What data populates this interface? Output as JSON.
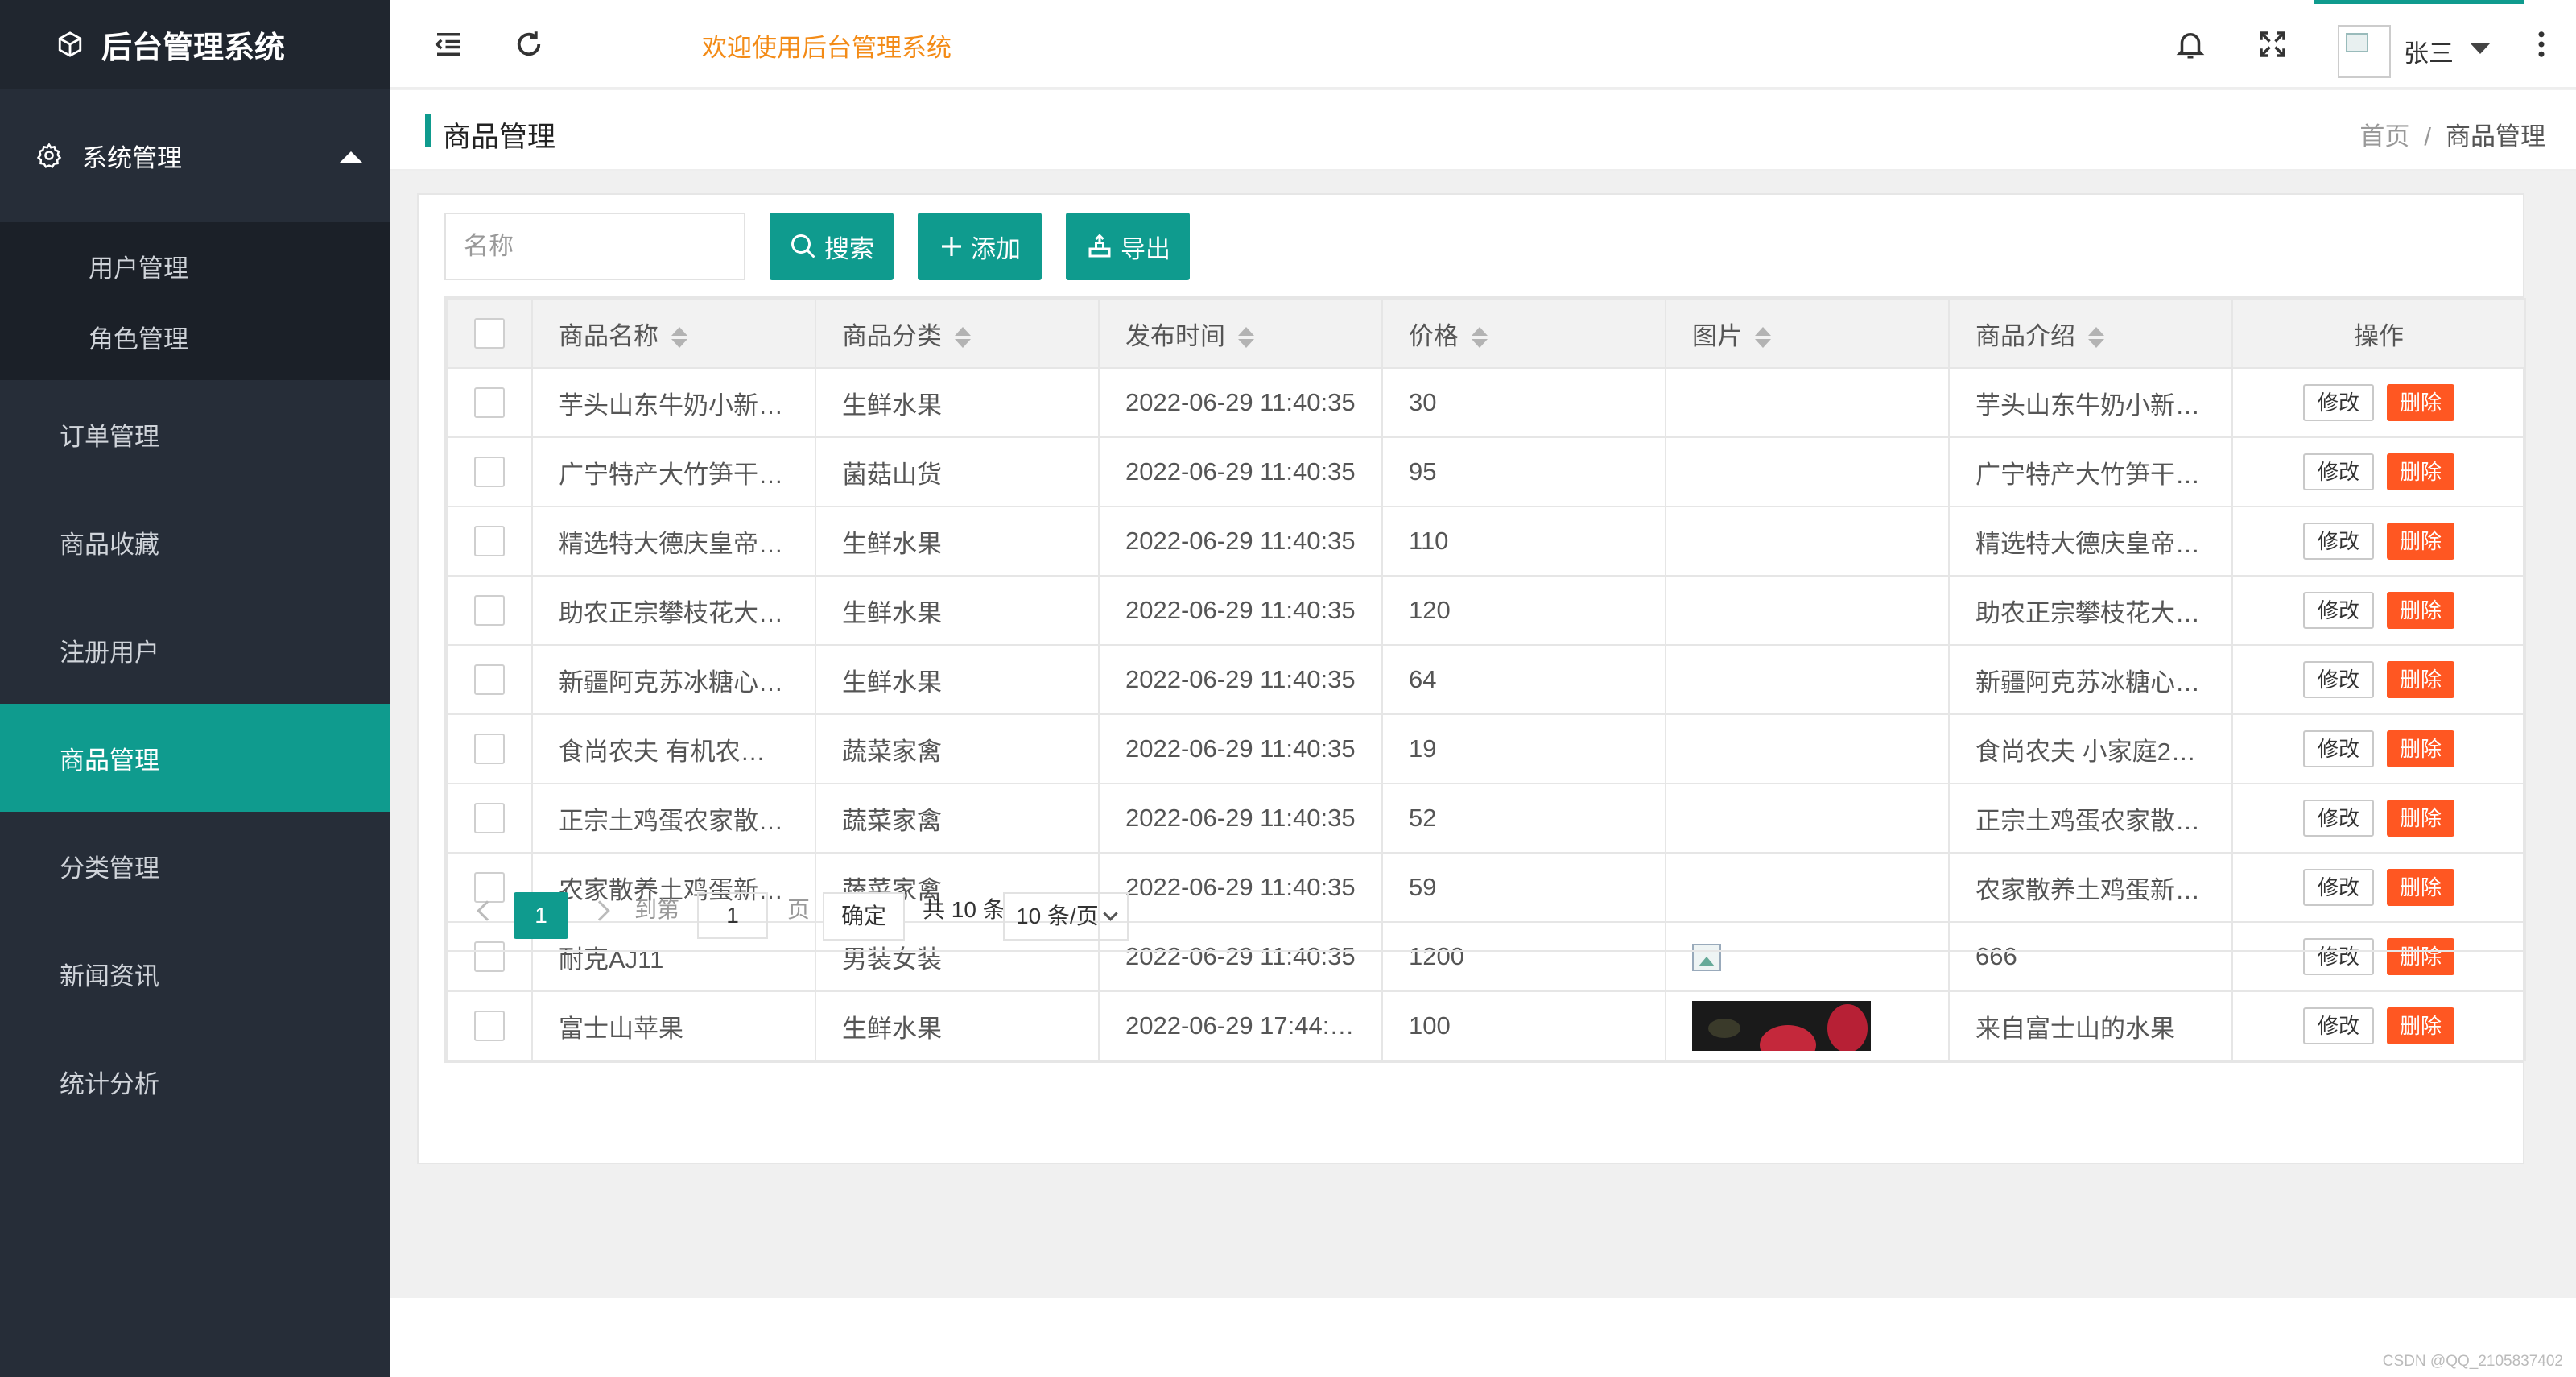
{
  "app": {
    "title": "后台管理系统"
  },
  "sidebar": {
    "group": {
      "label": "系统管理",
      "children": [
        "用户管理",
        "角色管理"
      ]
    },
    "items": [
      "订单管理",
      "商品收藏",
      "注册用户",
      "商品管理",
      "分类管理",
      "新闻资讯",
      "统计分析"
    ],
    "active": "商品管理"
  },
  "header": {
    "welcome": "欢迎使用后台管理系统",
    "user_name": "张三"
  },
  "page": {
    "title": "商品管理",
    "breadcrumb": {
      "home": "首页",
      "sep": "/",
      "current": "商品管理"
    }
  },
  "toolbar": {
    "search_placeholder": "名称",
    "search_label": "搜索",
    "add_label": "添加",
    "export_label": "导出"
  },
  "table": {
    "columns": [
      "商品名称",
      "商品分类",
      "发布时间",
      "价格",
      "图片",
      "商品介绍",
      "操作"
    ],
    "edit_label": "修改",
    "delete_label": "删除",
    "rows": [
      {
        "name": "芋头山东牛奶小新…",
        "category": "生鲜水果",
        "time": "2022-06-29 11:40:35",
        "price": "30",
        "image": "none",
        "intro": "芋头山东牛奶小新…"
      },
      {
        "name": "广宁特产大竹笋干…",
        "category": "菌菇山货",
        "time": "2022-06-29 11:40:35",
        "price": "95",
        "image": "none",
        "intro": "广宁特产大竹笋干…"
      },
      {
        "name": "精选特大德庆皇帝…",
        "category": "生鲜水果",
        "time": "2022-06-29 11:40:35",
        "price": "110",
        "image": "none",
        "intro": "精选特大德庆皇帝…"
      },
      {
        "name": "助农正宗攀枝花大…",
        "category": "生鲜水果",
        "time": "2022-06-29 11:40:35",
        "price": "120",
        "image": "none",
        "intro": "助农正宗攀枝花大…"
      },
      {
        "name": "新疆阿克苏冰糖心…",
        "category": "生鲜水果",
        "time": "2022-06-29 11:40:35",
        "price": "64",
        "image": "none",
        "intro": "新疆阿克苏冰糖心…"
      },
      {
        "name": "食尚农夫 有机农…",
        "category": "蔬菜家禽",
        "time": "2022-06-29 11:40:35",
        "price": "19",
        "image": "none",
        "intro": "食尚农夫 小家庭2…"
      },
      {
        "name": "正宗土鸡蛋农家散…",
        "category": "蔬菜家禽",
        "time": "2022-06-29 11:40:35",
        "price": "52",
        "image": "none",
        "intro": "正宗土鸡蛋农家散…"
      },
      {
        "name": "农家散养土鸡蛋新…",
        "category": "蔬菜家禽",
        "time": "2022-06-29 11:40:35",
        "price": "59",
        "image": "none",
        "intro": "农家散养土鸡蛋新…"
      },
      {
        "name": "耐克AJ11",
        "category": "男装女装",
        "time": "2022-06-29 11:40:35",
        "price": "1200",
        "image": "broken",
        "intro": "666"
      },
      {
        "name": "富士山苹果",
        "category": "生鲜水果",
        "time": "2022-06-29 17:44:…",
        "price": "100",
        "image": "apple-photo",
        "intro": "来自富士山的水果"
      }
    ]
  },
  "pagination": {
    "current_page": "1",
    "goto_prefix": "到第",
    "goto_value": "1",
    "goto_suffix": "页",
    "confirm_label": "确定",
    "total_text": "共 10 条",
    "page_size": "10 条/页"
  },
  "watermark": "CSDN @QQ_2105837402",
  "colors": {
    "accent": "#0f9b8e",
    "danger": "#ff5722",
    "sidebar": "#262d38",
    "welcome": "#f38b17"
  }
}
